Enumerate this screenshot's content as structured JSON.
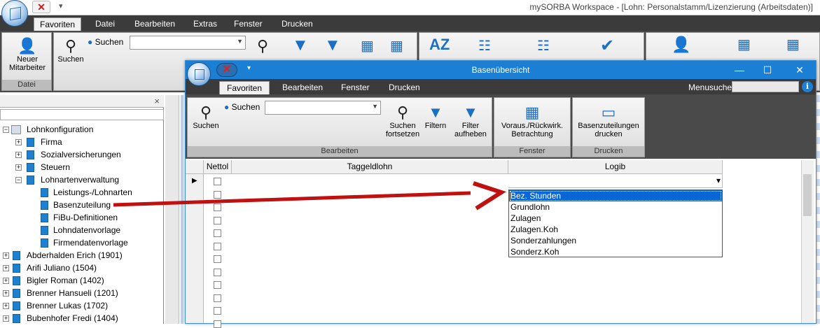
{
  "main": {
    "title": "mySORBA Workspace - [Lohn: Personalstamm/Lizenzierung (Arbeitsdaten)]",
    "qat_close": "✕",
    "qat_more": "▾",
    "tabs": [
      {
        "label": "Favoriten",
        "active": true
      },
      {
        "label": "Datei"
      },
      {
        "label": "Bearbeiten"
      },
      {
        "label": "Extras"
      },
      {
        "label": "Fenster"
      },
      {
        "label": "Drucken"
      }
    ],
    "ribbon": {
      "new_employee_l1": "Neuer",
      "new_employee_l2": "Mitarbeiter",
      "group_datei": "Datei",
      "search_label": "Suchen",
      "search_button": "Suchen"
    }
  },
  "tree": {
    "close": "×",
    "items": [
      {
        "label": "Lohnkonfiguration"
      },
      {
        "label": "Firma"
      },
      {
        "label": "Sozialversicherungen"
      },
      {
        "label": "Steuern"
      },
      {
        "label": "Lohnartenverwaltung"
      },
      {
        "label": "Leistungs-/Lohnarten"
      },
      {
        "label": "Basenzuteilung"
      },
      {
        "label": "FiBu-Definitionen"
      },
      {
        "label": "Lohndatenvorlage"
      },
      {
        "label": "Firmendatenvorlage"
      },
      {
        "label": "Abderhalden Erich (1901)"
      },
      {
        "label": "Arifi Juliano (1504)"
      },
      {
        "label": "Bigler Roman (1402)"
      },
      {
        "label": "Brenner Hansueli (1201)"
      },
      {
        "label": "Brenner Lukas (1702)"
      },
      {
        "label": "Bubenhofer Fredi (1404)"
      }
    ]
  },
  "child": {
    "title": "Basenübersicht",
    "close_btn": "✕",
    "qat_more": "▾",
    "win_min": "—",
    "win_max": "☐",
    "win_close": "✕",
    "tabs": [
      {
        "label": "Favoriten",
        "active": true
      },
      {
        "label": "Bearbeiten"
      },
      {
        "label": "Fenster"
      },
      {
        "label": "Drucken"
      }
    ],
    "menusuche": "Menusuche",
    "info": "i",
    "ribbon": {
      "search_label": "Suchen",
      "search_button": "Suchen",
      "continue_l1": "Suchen",
      "continue_l2": "fortsetzen",
      "filter": "Filtern",
      "filter_off_l1": "Filter",
      "filter_off_l2": "aufheben",
      "group_bearbeiten": "Bearbeiten",
      "preview_l1": "Voraus./Rückwirk.",
      "preview_l2": "Betrachtung",
      "group_fenster": "Fenster",
      "print_l1": "Basenzuteilungen",
      "print_l2": "drucken",
      "group_drucken": "Drucken"
    },
    "grid": {
      "headers": [
        "Nettol",
        "Taggeldlohn",
        "Logib"
      ],
      "row_indicator": "▶",
      "dropdown_arrow": "▾",
      "dropdown_options": [
        {
          "label": "Bez. Stunden",
          "selected": true
        },
        {
          "label": "Grundlohn"
        },
        {
          "label": "Zulagen"
        },
        {
          "label": "Zulagen.Koh"
        },
        {
          "label": "Sonderzahlungen"
        },
        {
          "label": "Sonderz.Koh"
        }
      ]
    }
  },
  "colors": {
    "title_bar_blue": "#1b7fd3",
    "dark_tab_bar": "#3b3b3b",
    "selection_blue": "#0a66d6",
    "arrow_red": "#c01010"
  }
}
